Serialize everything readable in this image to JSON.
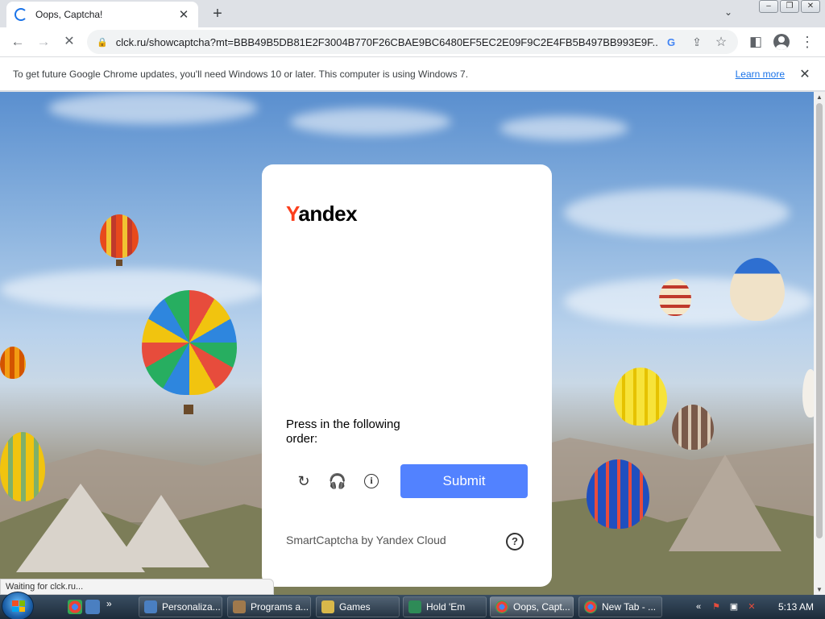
{
  "browser": {
    "tab": {
      "title": "Oops, Captcha!"
    },
    "url": "clck.ru/showcaptcha?mt=BBB49B5DB81E2F3004B770F26CBAE9BC6480EF5EC2E09F9C2E4FB5B497BB993E9F...",
    "infobar": {
      "message": "To get future Google Chrome updates, you'll need Windows 10 or later. This computer is using Windows 7.",
      "link": "Learn more"
    },
    "status": "Waiting for clck.ru..."
  },
  "captcha": {
    "logo_first": "Y",
    "logo_rest": "andex",
    "instruction": "Press in the following order:",
    "submit_label": "Submit",
    "footer": "SmartCaptcha by Yandex Cloud",
    "help": "?"
  },
  "taskbar": {
    "buttons": [
      {
        "label": "Personaliza..."
      },
      {
        "label": "Programs a..."
      },
      {
        "label": "Games"
      },
      {
        "label": "Hold 'Em"
      },
      {
        "label": "Oops, Capt..."
      },
      {
        "label": "New Tab - ..."
      }
    ],
    "time": "5:13 AM"
  },
  "colors": {
    "accent": "#5282ff",
    "logo_red": "#fc3f1d"
  }
}
